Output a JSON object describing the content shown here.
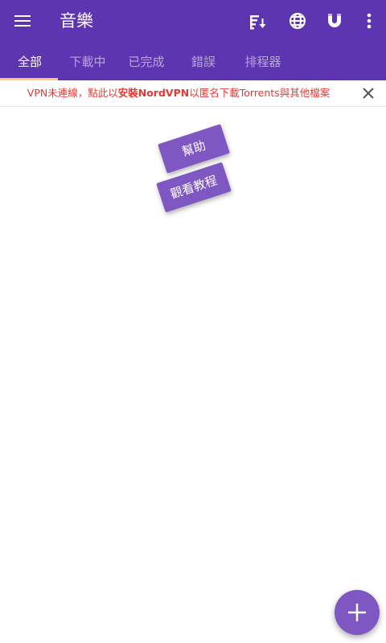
{
  "app": {
    "title": "音樂"
  },
  "toolbar": {
    "icons": [
      "sort-icon",
      "globe-icon",
      "magnet-icon",
      "more-vert-icon"
    ]
  },
  "tabs": [
    {
      "label": "全部",
      "active": true
    },
    {
      "label": "下載中",
      "active": false
    },
    {
      "label": "已完成",
      "active": false
    },
    {
      "label": "錯誤",
      "active": false
    },
    {
      "label": "排程器",
      "active": false
    }
  ],
  "banner": {
    "text_prefix": "VPN未連線，點此以",
    "text_bold": "安裝NordVPN",
    "text_suffix": "以匿名下載Torrents與其他檔案",
    "close_icon": "close-icon"
  },
  "help": {
    "help_label": "幫助",
    "tutorial_label": "觀看教程"
  },
  "colors": {
    "primary": "#5e35b1",
    "accent": "#7e57c2",
    "tab_indicator": "#ffc97a",
    "banner_text": "#e53935"
  }
}
